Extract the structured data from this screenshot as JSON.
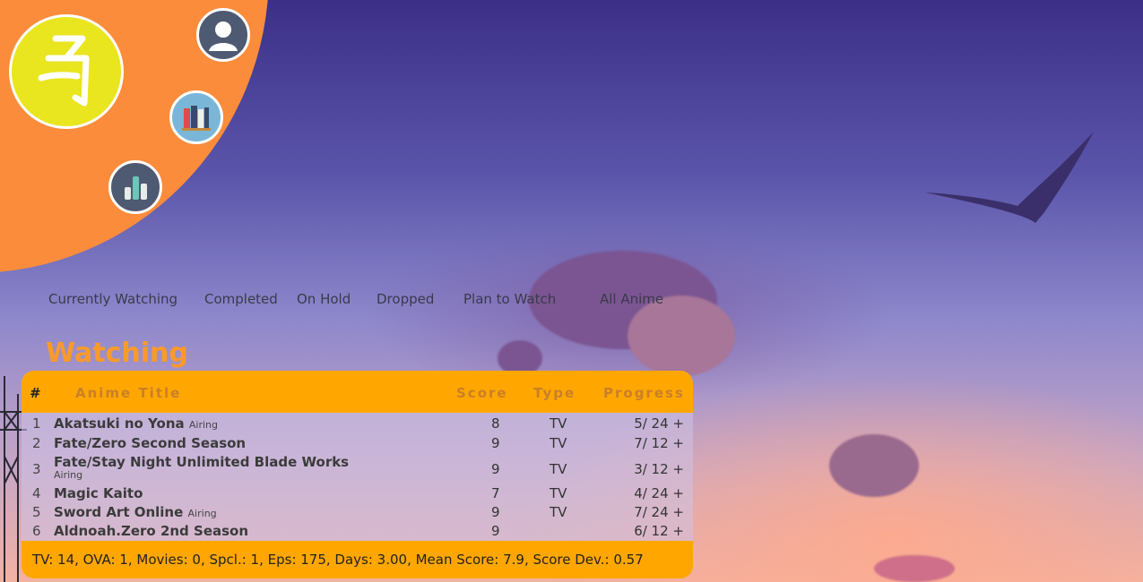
{
  "nav": {
    "tabs": [
      "Currently Watching",
      "Completed",
      "On Hold",
      "Dropped",
      "Plan to Watch",
      "All Anime"
    ]
  },
  "heading": "Watching",
  "table": {
    "headers": {
      "num": "#",
      "title": "Anime Title",
      "score": "Score",
      "type": "Type",
      "progress": "Progress"
    },
    "rows": [
      {
        "num": "1",
        "title": "Akatsuki no Yona",
        "status": "Airing",
        "score": "8",
        "type": "TV",
        "progress": "5/ 24",
        "plus": "+"
      },
      {
        "num": "2",
        "title": "Fate/Zero Second Season",
        "status": "",
        "score": "9",
        "type": "TV",
        "progress": "7/ 12",
        "plus": "+"
      },
      {
        "num": "3",
        "title": "Fate/Stay Night Unlimited Blade Works",
        "status": "Airing",
        "score": "9",
        "type": "TV",
        "progress": "3/ 12",
        "plus": "+"
      },
      {
        "num": "4",
        "title": "Magic Kaito",
        "status": "",
        "score": "7",
        "type": "TV",
        "progress": "4/ 24",
        "plus": "+"
      },
      {
        "num": "5",
        "title": "Sword Art Online",
        "status": "Airing",
        "score": "9",
        "type": "TV",
        "progress": "7/ 24",
        "plus": "+"
      },
      {
        "num": "6",
        "title": "Aldnoah.Zero 2nd Season",
        "status": "",
        "score": "9",
        "type": "",
        "progress": "6/ 12",
        "plus": "+"
      }
    ],
    "footer": "TV: 14, OVA: 1, Movies: 0, Spcl.: 1, Eps: 175, Days: 3.00, Mean Score: 7.9, Score Dev.: 0.57"
  },
  "icons": {
    "logo": "kana-logo-icon",
    "profile": "user-icon",
    "list": "books-icon",
    "stats": "bar-chart-icon"
  },
  "colors": {
    "accent": "#fb8c3b",
    "header": "#ffa700",
    "logo": "#e9e51f",
    "heading": "#fb9a2a"
  }
}
